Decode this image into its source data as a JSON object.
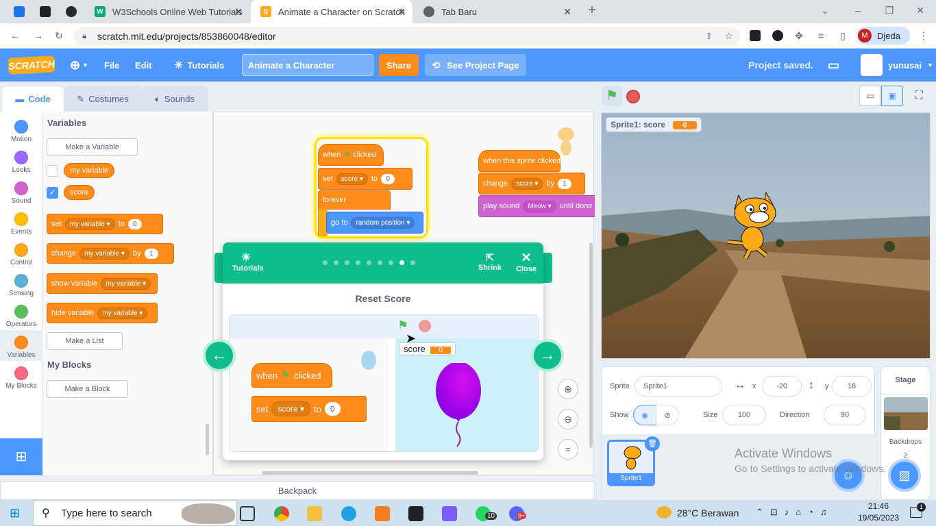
{
  "browser": {
    "tabs": [
      {
        "title": "W3Schools Online Web Tutorials",
        "active": false
      },
      {
        "title": "Animate a Character on Scratch",
        "active": true
      },
      {
        "title": "Tab Baru",
        "active": false
      }
    ],
    "url": "scratch.mit.edu/projects/853860048/editor",
    "profile_initial": "M",
    "profile_name": "Djeda"
  },
  "menubar": {
    "logo": "SCRATCH",
    "file": "File",
    "edit": "Edit",
    "tutorials": "Tutorials",
    "project_title": "Animate a Character",
    "share": "Share",
    "see_project": "See Project Page",
    "status": "Project saved.",
    "username": "yunusai"
  },
  "editor_tabs": {
    "code": "Code",
    "costumes": "Costumes",
    "sounds": "Sounds"
  },
  "categories": [
    {
      "label": "Motion",
      "color": "#4c97ff"
    },
    {
      "label": "Looks",
      "color": "#9966ff"
    },
    {
      "label": "Sound",
      "color": "#cf63cf"
    },
    {
      "label": "Events",
      "color": "#ffbf00"
    },
    {
      "label": "Control",
      "color": "#ffab19"
    },
    {
      "label": "Sensing",
      "color": "#5cb1d6"
    },
    {
      "label": "Operators",
      "color": "#59c059"
    },
    {
      "label": "Variables",
      "color": "#ff8c1a"
    },
    {
      "label": "My Blocks",
      "color": "#ff6680"
    }
  ],
  "palette": {
    "variables_heading": "Variables",
    "make_variable": "Make a Variable",
    "var1": "my variable",
    "var2": "score",
    "set_word": "set",
    "to_word": "to",
    "set_value": "0",
    "change_word": "change",
    "by_word": "by",
    "change_value": "1",
    "show_variable": "show variable",
    "hide_variable": "hide variable",
    "make_list": "Make a List",
    "myblocks_heading": "My Blocks",
    "make_block": "Make a Block"
  },
  "script": {
    "when_flag": "when",
    "clicked": "clicked",
    "set": "set",
    "score": "score",
    "to": "to",
    "zero": "0",
    "forever": "forever",
    "go_to": "go to",
    "random_position": "random position",
    "when_sprite_clicked": "when this sprite clicked",
    "change": "change",
    "by": "by",
    "one": "1",
    "play_sound": "play sound",
    "meow": "Meow",
    "until_done": "until done"
  },
  "tutorial": {
    "tutorials_label": "Tutorials",
    "shrink": "Shrink",
    "close": "Close",
    "title": "Reset Score",
    "step_count": 9,
    "current_step": 8,
    "preview_monitor_label": "score",
    "preview_monitor_value": "0",
    "preview_when": "when",
    "preview_clicked": "clicked",
    "preview_set": "set",
    "preview_score": "score",
    "preview_to": "to",
    "preview_value": "0"
  },
  "stage": {
    "monitor_label": "Sprite1: score",
    "monitor_value": "0"
  },
  "sprite_info": {
    "sprite_label": "Sprite",
    "sprite_name": "Sprite1",
    "x_label": "x",
    "x_value": "-20",
    "y_label": "y",
    "y_value": "18",
    "show_label": "Show",
    "size_label": "Size",
    "size_value": "100",
    "direction_label": "Direction",
    "direction_value": "90",
    "thumb_name": "Sprite1"
  },
  "stage_panel": {
    "title": "Stage",
    "backdrops_label": "Backdrops",
    "backdrops_count": "2"
  },
  "backpack": "Backpack",
  "watermark": {
    "line1": "Activate Windows",
    "line2": "Go to Settings to activate Windows."
  },
  "taskbar": {
    "search_placeholder": "Type here to search",
    "weather": "28°C  Berawan",
    "time": "21:46",
    "date": "19/05/2023",
    "whatsapp_badge": "10",
    "discord_badge": "9+",
    "notif_badge": "1"
  }
}
